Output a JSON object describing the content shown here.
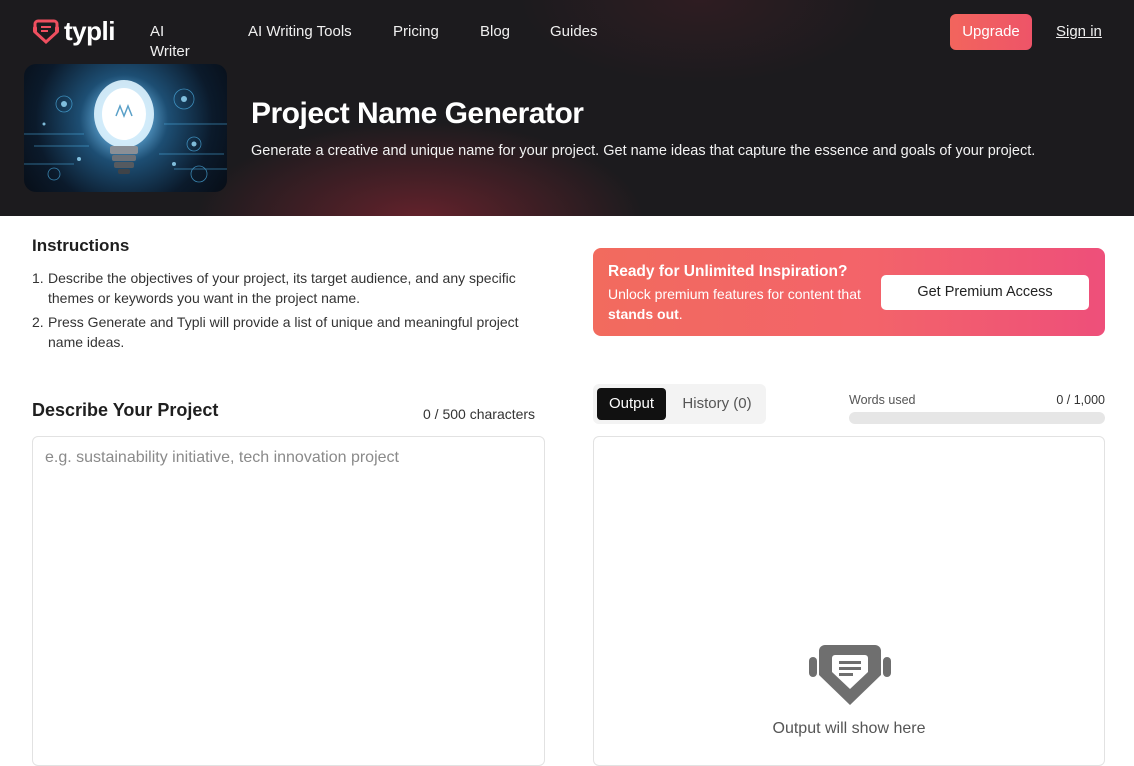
{
  "brand": {
    "name": "typli",
    "accent": "#f2655d"
  },
  "nav": {
    "items": [
      "AI Writer",
      "AI Writing Tools",
      "Pricing",
      "Blog",
      "Guides"
    ],
    "upgrade_label": "Upgrade",
    "signin_label": "Sign in"
  },
  "hero": {
    "title": "Project Name Generator",
    "subtitle": "Generate a creative and unique name for your project. Get name ideas that capture the essence and goals of your project.",
    "image_icon": "lightbulb-illustration"
  },
  "instructions": {
    "title": "Instructions",
    "steps": [
      {
        "num": "1.",
        "text": "Describe the objectives of your project, its target audience, and any specific themes or keywords you want in the project name."
      },
      {
        "num": "2.",
        "text": "Press Generate and Typli will provide a list of unique and meaningful project name ideas."
      }
    ]
  },
  "promo": {
    "title": "Ready for Unlimited Inspiration?",
    "text_before": "Unlock premium features for content that ",
    "text_bold": "stands out",
    "text_after": ".",
    "button_label": "Get Premium Access"
  },
  "describe": {
    "title": "Describe Your Project",
    "char_count": "0 / 500 characters",
    "value": "",
    "placeholder": "e.g. sustainability initiative, tech innovation project"
  },
  "output": {
    "tabs": {
      "output_label": "Output",
      "history_label": "History (0)"
    },
    "words_used_label": "Words used",
    "words_used_count": "0 / 1,000",
    "words_used_fraction": 0,
    "placeholder_text": "Output will show here",
    "placeholder_icon": "typli-logo-icon"
  }
}
